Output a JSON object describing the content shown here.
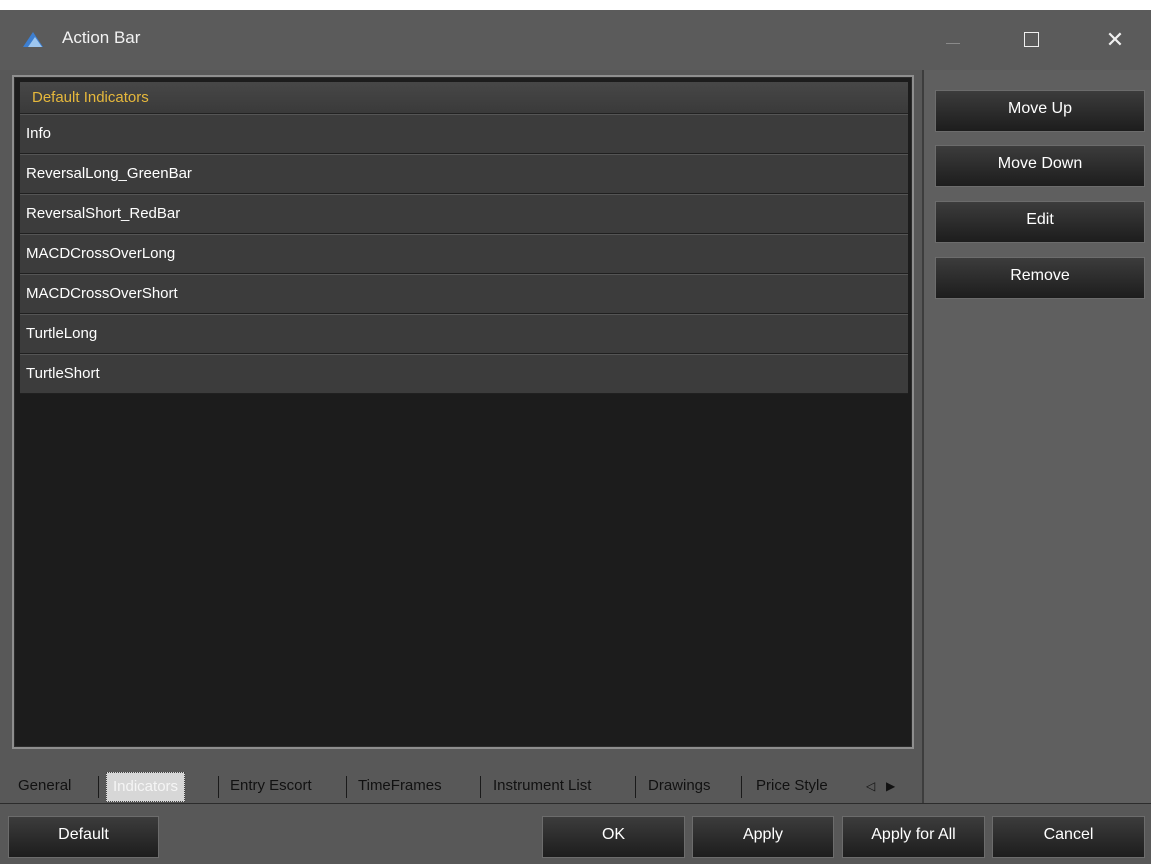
{
  "window": {
    "title": "Action Bar",
    "minimize_label": "—",
    "close_label": "✕"
  },
  "list": {
    "header": "Default Indicators",
    "items": [
      "Info",
      "ReversalLong_GreenBar",
      "ReversalShort_RedBar",
      "MACDCrossOverLong",
      "MACDCrossOverShort",
      "TurtleLong",
      "TurtleShort"
    ]
  },
  "tabs": {
    "items": [
      "General",
      "Indicators",
      "Entry Escort",
      "TimeFrames",
      "Instrument List",
      "Drawings",
      "Price Style"
    ],
    "active": "Indicators",
    "prev_arrow": "◁",
    "next_arrow": "▶"
  },
  "side_buttons": {
    "move_up": "Move Up",
    "move_down": "Move Down",
    "edit": "Edit",
    "remove": "Remove"
  },
  "footer": {
    "default": "Default",
    "ok": "OK",
    "apply": "Apply",
    "apply_all": "Apply for All",
    "cancel": "Cancel"
  },
  "colors": {
    "header_text": "#e6b83c",
    "list_bg": "#1c1c1c",
    "panel_bg": "#585858"
  }
}
